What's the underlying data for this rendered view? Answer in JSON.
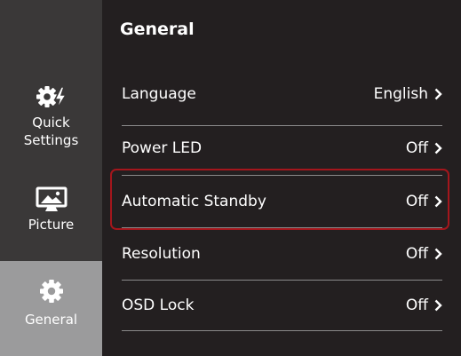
{
  "sidebar": {
    "items": [
      {
        "label": "Quick\nSettings",
        "icon": "quick-settings-gear-bolt-icon"
      },
      {
        "label": "Picture",
        "icon": "monitor-picture-icon"
      },
      {
        "label": "General",
        "icon": "gear-icon",
        "selected": true
      }
    ]
  },
  "main": {
    "title": "General",
    "rows": [
      {
        "label": "Language",
        "value": "English"
      },
      {
        "label": "Power LED",
        "value": "Off"
      },
      {
        "label": "Automatic Standby",
        "value": "Off",
        "highlighted": true
      },
      {
        "label": "Resolution",
        "value": "Off"
      },
      {
        "label": "OSD Lock",
        "value": "Off"
      }
    ]
  },
  "colors": {
    "background": "#231f20",
    "sidebar": "#3a3838",
    "selected_nav": "#9b9b9c",
    "highlight_border": "#a4161c",
    "divider": "#8a8a8a"
  }
}
